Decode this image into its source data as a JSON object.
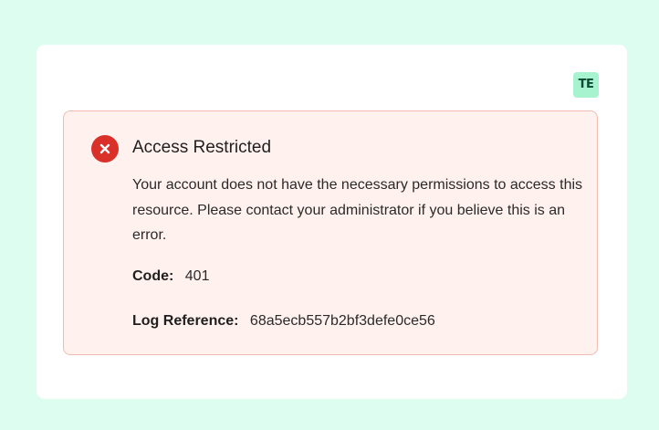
{
  "logo": {
    "text": "TE"
  },
  "alert": {
    "icon": "error-x-icon",
    "title": "Access Restricted",
    "message": "Your account does not have the necessary permissions to access this resource. Please contact your administrator if you believe this is an error.",
    "code_label": "Code:",
    "code_value": "401",
    "log_label": "Log Reference:",
    "log_value": "68a5ecb557b2bf3defe0ce56"
  },
  "colors": {
    "background": "#dcfdf0",
    "card": "#ffffff",
    "alert_bg": "#fff1ee",
    "alert_border": "#f2bcb0",
    "error_red": "#d9302a",
    "logo_bg": "#a7f3d0"
  }
}
